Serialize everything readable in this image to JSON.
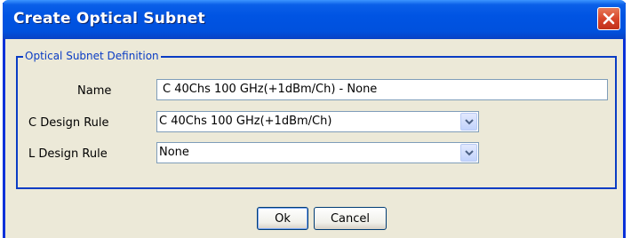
{
  "dialog": {
    "title": "Create Optical Subnet",
    "close_icon": "close-icon"
  },
  "fieldset": {
    "legend": "Optical Subnet Definition"
  },
  "form": {
    "name_label": "Name",
    "name_value": "C 40Chs 100 GHz(+1dBm/Ch) - None",
    "c_rule_label": "C Design Rule",
    "c_rule_value": "C 40Chs 100 GHz(+1dBm/Ch)",
    "l_rule_label": "L Design Rule",
    "l_rule_value": "None",
    "dropdown_icon": "chevron-down-icon"
  },
  "buttons": {
    "ok_label": "Ok",
    "cancel_label": "Cancel"
  },
  "figure_id": "340771",
  "colors": {
    "title_bar": "#0054e3",
    "close_button": "#d8462b",
    "frame_border": "#0a3cc4",
    "dialog_bg": "#ece9d8"
  }
}
